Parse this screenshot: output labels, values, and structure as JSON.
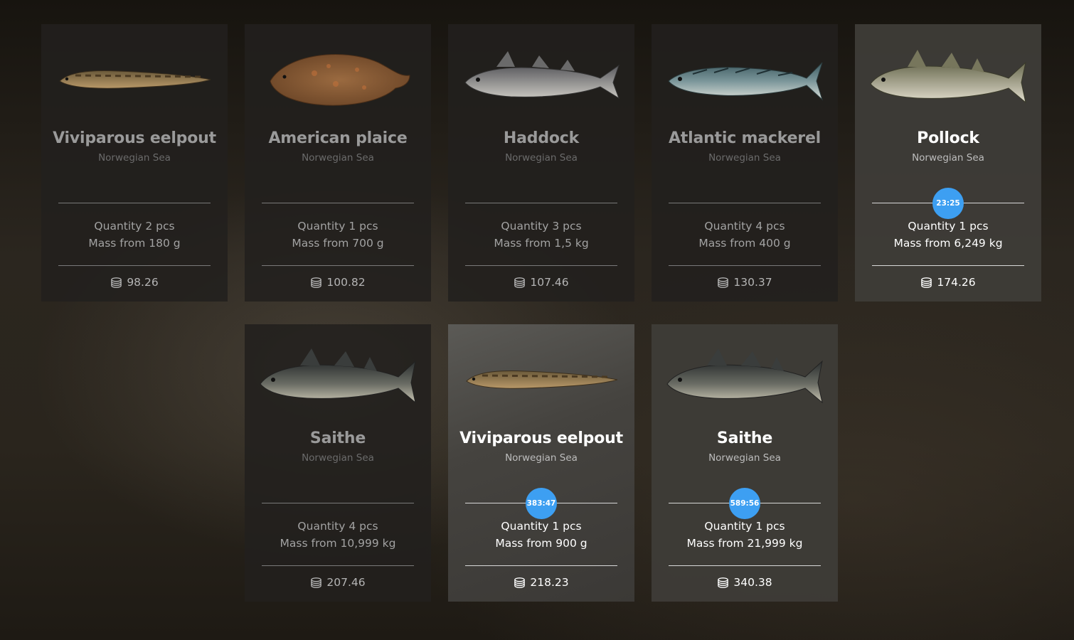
{
  "cards": [
    {
      "name": "Viviparous eelpout",
      "region": "Norwegian Sea",
      "quantity": "Quantity 2 pcs",
      "mass": "Mass from 180 g",
      "price": "98.26",
      "fish_icon": "eelpout-icon"
    },
    {
      "name": "American plaice",
      "region": "Norwegian Sea",
      "quantity": "Quantity 1 pcs",
      "mass": "Mass from 700 g",
      "price": "100.82",
      "fish_icon": "plaice-icon"
    },
    {
      "name": "Haddock",
      "region": "Norwegian Sea",
      "quantity": "Quantity 3 pcs",
      "mass": "Mass from 1,5 kg",
      "price": "107.46",
      "fish_icon": "haddock-icon"
    },
    {
      "name": "Atlantic mackerel",
      "region": "Norwegian Sea",
      "quantity": "Quantity 4 pcs",
      "mass": "Mass from 400 g",
      "price": "130.37",
      "fish_icon": "mackerel-icon"
    },
    {
      "name": "Pollock",
      "region": "Norwegian Sea",
      "quantity": "Quantity 1 pcs",
      "mass": "Mass from 6,249 kg",
      "price": "174.26",
      "timer": "23:25",
      "active": true,
      "fish_icon": "pollock-icon"
    },
    {
      "name": "Saithe",
      "region": "Norwegian Sea",
      "quantity": "Quantity 4 pcs",
      "mass": "Mass from 10,999 kg",
      "price": "207.46",
      "fish_icon": "saithe-icon"
    },
    {
      "name": "Viviparous eelpout",
      "region": "Norwegian Sea",
      "quantity": "Quantity 1 pcs",
      "mass": "Mass from 900 g",
      "price": "218.23",
      "timer": "383:47",
      "active": true,
      "fish_icon": "eelpout-icon"
    },
    {
      "name": "Saithe",
      "region": "Norwegian Sea",
      "quantity": "Quantity 1 pcs",
      "mass": "Mass from 21,999 kg",
      "price": "340.38",
      "timer": "589:56",
      "active": true,
      "fish_icon": "saithe-icon"
    }
  ],
  "colors": {
    "timer": "#3d9ff2",
    "active_text": "#ffffff",
    "inactive_text": "#9a9a9a"
  }
}
